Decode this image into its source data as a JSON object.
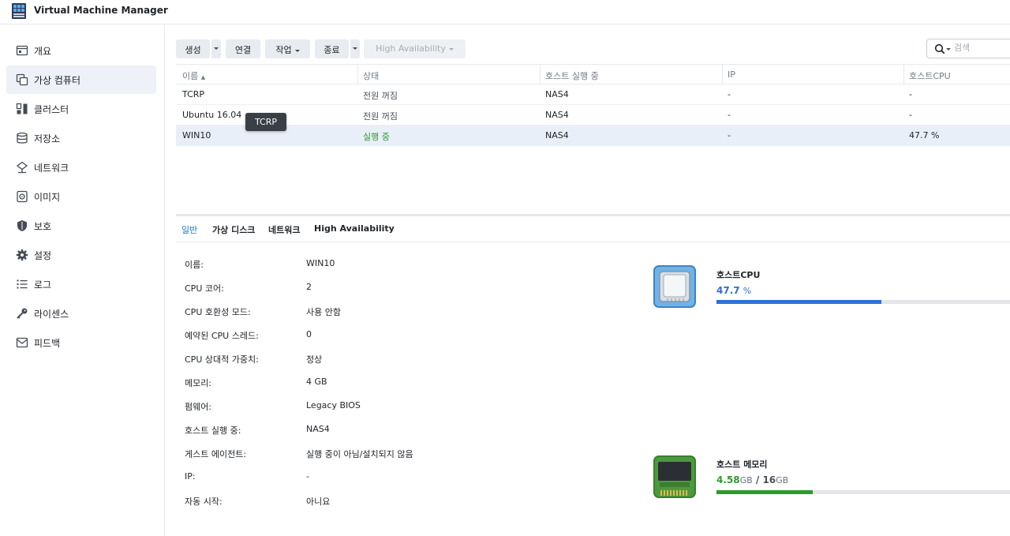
{
  "app": {
    "title": "Virtual Machine Manager"
  },
  "sidebar": {
    "items": [
      {
        "label": "개요",
        "icon": "overview-icon"
      },
      {
        "label": "가상 컴퓨터",
        "icon": "virtual-machine-icon",
        "active": true
      },
      {
        "label": "클러스터",
        "icon": "cluster-icon"
      },
      {
        "label": "저장소",
        "icon": "storage-icon"
      },
      {
        "label": "네트워크",
        "icon": "network-icon"
      },
      {
        "label": "이미지",
        "icon": "image-icon"
      },
      {
        "label": "보호",
        "icon": "shield-icon"
      },
      {
        "label": "설정",
        "icon": "gear-icon"
      },
      {
        "label": "로그",
        "icon": "log-list-icon"
      },
      {
        "label": "라이센스",
        "icon": "key-icon"
      },
      {
        "label": "피드백",
        "icon": "mail-icon"
      }
    ]
  },
  "toolbar": {
    "create": "생성",
    "connect": "연결",
    "action": "작업",
    "shutdown": "종료",
    "high_availability": "High Availability"
  },
  "search": {
    "placeholder": "검색"
  },
  "grid": {
    "columns": [
      "이름",
      "상태",
      "호스트 실행 중",
      "IP",
      "호스트CPU"
    ],
    "rows": [
      {
        "name": "TCRP",
        "status": "전원 꺼짐",
        "host": "NAS4",
        "ip": "-",
        "cpu": "-"
      },
      {
        "name": "Ubuntu 16.04",
        "status": "전원 꺼짐",
        "host": "NAS4",
        "ip": "-",
        "cpu": "-"
      },
      {
        "name": "WIN10",
        "status": "실행 중",
        "host": "NAS4",
        "ip": "-",
        "cpu": "47.7 %"
      }
    ]
  },
  "tooltip": {
    "text": "TCRP"
  },
  "tabs": [
    "일반",
    "가상 디스크",
    "네트워크",
    "High Availability"
  ],
  "details": [
    {
      "label": "이름:",
      "value": "WIN10"
    },
    {
      "label": "CPU 코어:",
      "value": "2"
    },
    {
      "label": "CPU 호환성 모드:",
      "value": "사용 안함"
    },
    {
      "label": "예약된 CPU 스레드:",
      "value": "0"
    },
    {
      "label": "CPU 상대적 가중치:",
      "value": "정상"
    },
    {
      "label": "메모리:",
      "value": "4 GB"
    },
    {
      "label": "펌웨어:",
      "value": "Legacy BIOS"
    },
    {
      "label": "호스트 실행 중:",
      "value": "NAS4"
    },
    {
      "label": "게스트 에이전트:",
      "value": "실행 중이 아님/설치되지 않음"
    },
    {
      "label": "IP:",
      "value": "-"
    },
    {
      "label": "자동 시작:",
      "value": "아니요"
    }
  ],
  "resources": {
    "cpu": {
      "title": "호스트CPU",
      "value": "47.7",
      "unit": "%",
      "percent": 47.7,
      "color": "#2f6fd6"
    },
    "memory": {
      "title": "호스트 메모리",
      "used": "4.58",
      "used_unit": "GB",
      "separator": "/",
      "total": "16",
      "total_unit": "GB",
      "fraction": 0.286,
      "color": "#2f9a2f"
    }
  }
}
